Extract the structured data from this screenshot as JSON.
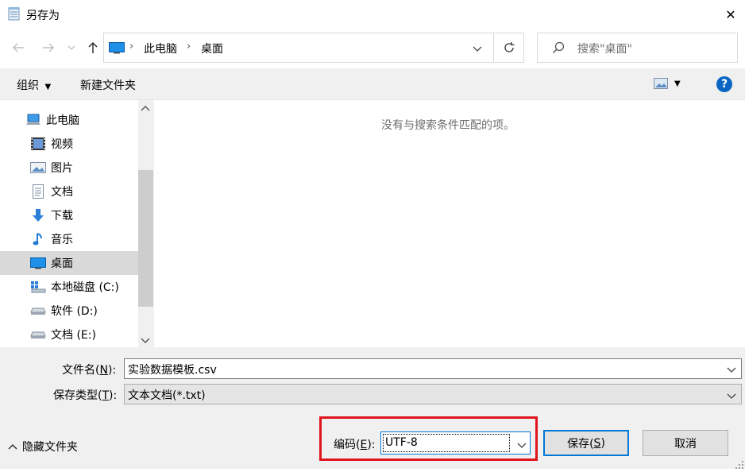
{
  "window": {
    "title": "另存为",
    "close_glyph": "✕"
  },
  "nav": {
    "back_icon": "arrow-left-icon",
    "forward_icon": "arrow-right-icon",
    "recent_icon": "chevron-down-icon",
    "up_icon": "arrow-up-icon",
    "breadcrumb": [
      "此电脑",
      "桌面"
    ],
    "refresh_icon": "refresh-icon",
    "search_placeholder": "搜索\"桌面\""
  },
  "toolbar": {
    "organize_label": "组织",
    "new_folder_label": "新建文件夹",
    "help_glyph": "?"
  },
  "tree": [
    {
      "label": "此电脑",
      "icon": "computer-icon",
      "selected": false
    },
    {
      "label": "视频",
      "icon": "video-icon",
      "selected": false
    },
    {
      "label": "图片",
      "icon": "picture-icon",
      "selected": false
    },
    {
      "label": "文档",
      "icon": "document-icon",
      "selected": false
    },
    {
      "label": "下载",
      "icon": "download-icon",
      "selected": false
    },
    {
      "label": "音乐",
      "icon": "music-icon",
      "selected": false
    },
    {
      "label": "桌面",
      "icon": "desktop-icon",
      "selected": true
    },
    {
      "label": "本地磁盘 (C:)",
      "icon": "local-disk-icon",
      "selected": false
    },
    {
      "label": "软件 (D:)",
      "icon": "drive-icon",
      "selected": false
    },
    {
      "label": "文档 (E:)",
      "icon": "drive-icon",
      "selected": false
    }
  ],
  "content": {
    "empty_message": "没有与搜索条件匹配的项。"
  },
  "form": {
    "filename_label_prefix": "文件名(",
    "filename_label_key": "N",
    "filename_label_suffix": "):",
    "filename_value": "实验数据模板.csv",
    "filetype_label_prefix": "保存类型(",
    "filetype_label_key": "T",
    "filetype_label_suffix": "):",
    "filetype_value": "文本文档(*.txt)",
    "hide_folders_label": "隐藏文件夹",
    "encoding_label_prefix": "编码(",
    "encoding_label_key": "E",
    "encoding_label_suffix": "):",
    "encoding_value": "UTF-8",
    "save_label_prefix": "保存(",
    "save_label_key": "S",
    "save_label_suffix": ")",
    "cancel_label": "取消"
  },
  "colors": {
    "accent": "#0078d7",
    "highlight": "#e0141e",
    "help": "#0b66c3"
  }
}
